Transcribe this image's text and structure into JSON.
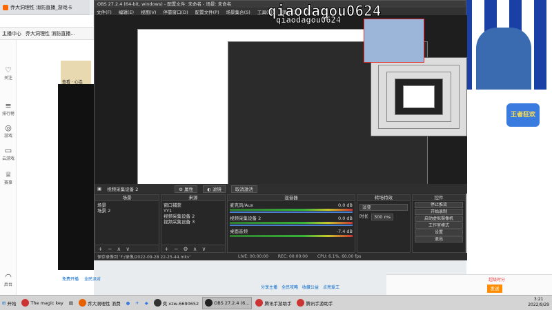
{
  "browser": {
    "tabs": [
      "乔大洞理性 消防直播_游戏卡"
    ],
    "bookmarks": [
      "主播中心",
      "乔大洞理性 消防直播..."
    ]
  },
  "left_nav": [
    {
      "label": "关注",
      "icon": "heart-icon"
    },
    {
      "label": "排行榜",
      "icon": "ranking-icon"
    },
    {
      "label": "游戏",
      "icon": "game-icon"
    },
    {
      "label": "云游戏",
      "icon": "cloud-game-icon"
    },
    {
      "label": "赛事",
      "icon": "trophy-icon"
    },
    {
      "label": "后台",
      "icon": "headset-icon"
    }
  ],
  "page": {
    "streamer_tag": "查看 · 心连"
  },
  "obs": {
    "title": "OBS 27.2.4 (64-bit, windows) - 配置文件: 未命名 - 场景: 未命名",
    "menu": [
      "文件(F)",
      "编辑(E)",
      "视图(V)",
      "停靠窗口(D)",
      "配置文件(P)",
      "场景集合(S)",
      "工具(T)",
      "帮助(H)"
    ],
    "source_bar": {
      "current": "视频采集设备 2",
      "props": "属性",
      "filters": "滤镜",
      "deactivate": "取消激活"
    },
    "docks": {
      "scenes": {
        "title": "场景",
        "items": [
          "场景",
          "场景 2"
        ]
      },
      "sources": {
        "title": "来源",
        "items": [
          "窗口捕获",
          "YY1",
          "视频采集设备 2",
          "视频采集设备 3"
        ]
      },
      "mixer": {
        "title": "混音器",
        "channels": [
          {
            "name": "麦克风/Aux",
            "db": "0.0 dB"
          },
          {
            "name": "视频采集设备 2",
            "db": "0.0 dB"
          },
          {
            "name": "桌面音频",
            "db": "-7.4 dB"
          }
        ]
      },
      "transitions": {
        "title": "转场特效",
        "type": "淡变",
        "duration_label": "时长",
        "duration": "300 ms"
      },
      "controls": {
        "title": "控件",
        "buttons": [
          "停止推流",
          "开始录制",
          "启动虚拟摄像机",
          "工作室模式",
          "设置",
          "退出"
        ]
      }
    },
    "status": {
      "recording": "保存录像到 'F:/录像/2022-09-28 22-25-44.mkv'",
      "live": "LIVE: 00:00:00",
      "rec": "REC: 00:00:00",
      "cpu": "CPU: 6.1%, 60.00 fps"
    }
  },
  "overlay": {
    "streamer_name": "qiaodagou0624",
    "streamer_name_small": "qiaodagou0624"
  },
  "right_panel": {
    "badge": "王者狂欢",
    "buttons": [
      "发送"
    ],
    "chat_hint": "超级时分"
  },
  "bottom_icons": [
    "免费开播",
    "全民派对",
    "分享主播",
    "全民攻略",
    "收藏公益",
    "点亮爱工"
  ],
  "taskbar": {
    "start": "开始",
    "items": [
      "The magic key",
      "乔大洞理性 消费",
      "",
      "",
      "",
      "",
      "奕 xzw-6690652",
      "OBS 27.2.4 (6...",
      "腾讯手游助手",
      "腾讯手游助手"
    ],
    "time": "3:21",
    "date": "2022/9/29"
  },
  "colors": {
    "obs_bg": "#2a2a2a",
    "accent_blue": "#1a3fa5",
    "cam_border": "#e03030"
  }
}
